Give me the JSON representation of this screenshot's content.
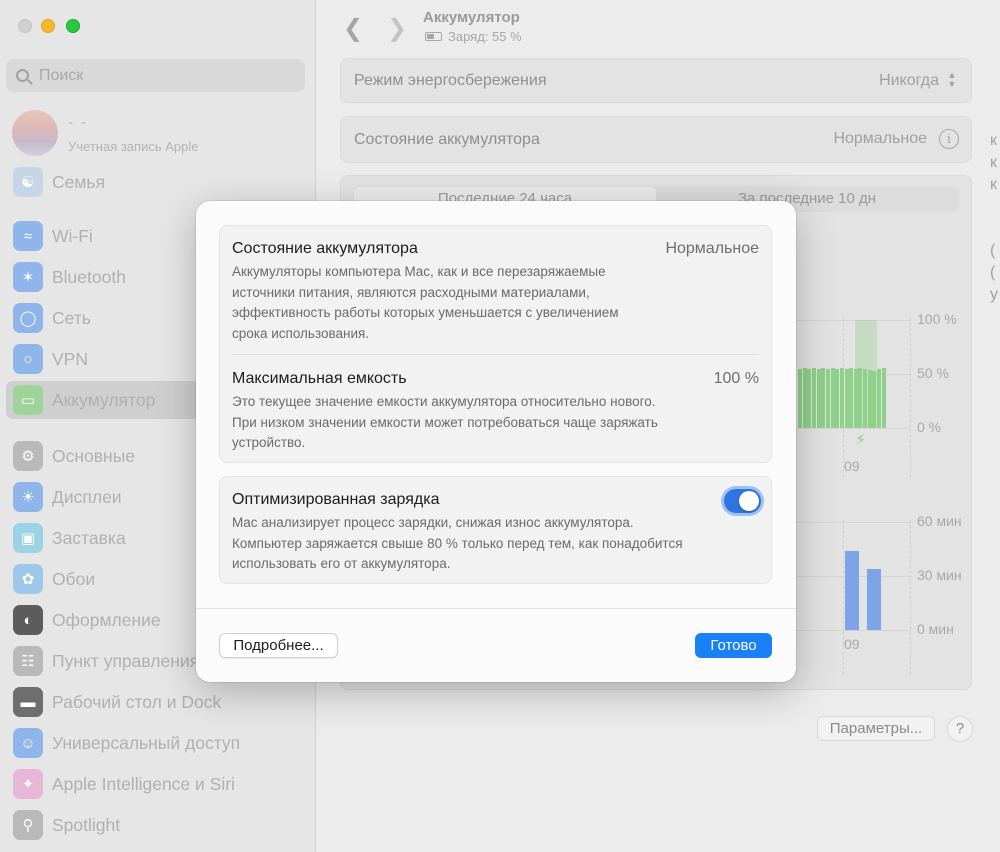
{
  "sidebar": {
    "search_placeholder": "Поиск",
    "account": {
      "name": "- -",
      "subtitle": "Учетная запись Apple"
    },
    "items": [
      {
        "label": "Семья",
        "icon": "family-icon",
        "color": "#c7d6e6"
      },
      {
        "label": "Wi-Fi",
        "icon": "wifi-icon",
        "color": "#8fb5ea"
      },
      {
        "label": "Bluetooth",
        "icon": "bluetooth-icon",
        "color": "#8fb5ea"
      },
      {
        "label": "Сеть",
        "icon": "globe-icon",
        "color": "#8fb5ea"
      },
      {
        "label": "VPN",
        "icon": "vpn-icon",
        "color": "#8fb5ea"
      },
      {
        "label": "Аккумулятор",
        "icon": "battery-icon",
        "color": "#9ed39a"
      },
      {
        "label": "Основные",
        "icon": "gear-icon",
        "color": "#b9b9b9"
      },
      {
        "label": "Дисплеи",
        "icon": "sun-icon",
        "color": "#8fb5ea"
      },
      {
        "label": "Заставка",
        "icon": "screensaver-icon",
        "color": "#9dd1e6"
      },
      {
        "label": "Обои",
        "icon": "flower-icon",
        "color": "#9dc8ea"
      },
      {
        "label": "Оформление",
        "icon": "appearance-icon",
        "color": "#5c5c5c"
      },
      {
        "label": "Пункт управления",
        "icon": "control-center-icon",
        "color": "#b9b9b9"
      },
      {
        "label": "Рабочий стол и Dock",
        "icon": "dock-icon",
        "color": "#6e6e6e"
      },
      {
        "label": "Универсальный доступ",
        "icon": "accessibility-icon",
        "color": "#8fb5ea"
      },
      {
        "label": "Apple Intelligence и Siri",
        "icon": "siri-icon",
        "color": "#e6b7d6"
      },
      {
        "label": "Spotlight",
        "icon": "spotlight-icon",
        "color": "#b9b9b9"
      }
    ],
    "active_item": "Аккумулятор"
  },
  "header": {
    "title": "Аккумулятор",
    "subtitle": "Заряд: 55 %"
  },
  "main": {
    "low_power": {
      "label": "Режим энергосбережения",
      "value": "Никогда"
    },
    "health": {
      "label": "Состояние аккумулятора",
      "value": "Нормальное"
    },
    "tabs": [
      "Последние 24 часа",
      "За последние 10 дн"
    ],
    "charge_chart": {
      "y_ticks": [
        "100 %",
        "50 %",
        "0 %"
      ],
      "x_tick": "09",
      "bar_color": "#8fd08a"
    },
    "usage_chart": {
      "y_ticks": [
        "60 мин",
        "30 мин",
        "0 мин"
      ],
      "x_tick": "09",
      "bar_color": "#7da4e6"
    },
    "params_button": "Параметры...",
    "help_button": "?",
    "edge_glyphs": [
      "к",
      "к",
      "к",
      "",
      "",
      "(",
      "(",
      "у"
    ]
  },
  "chart_data": [
    {
      "type": "bar",
      "y_ticks": [
        "100 %",
        "50 %",
        "0 %"
      ],
      "x_labels": [
        "09"
      ],
      "ylim": [
        0,
        100
      ],
      "values": [
        55,
        56,
        55,
        56,
        55,
        56,
        55,
        56,
        55,
        56,
        55,
        56,
        55,
        56,
        55,
        54,
        53,
        55,
        56
      ],
      "highlight_last": 100
    },
    {
      "type": "bar",
      "y_ticks": [
        "60 мин",
        "30 мин",
        "0 мин"
      ],
      "x_labels": [
        "09"
      ],
      "ylim": [
        0,
        60
      ],
      "values": [
        44,
        34
      ]
    }
  ],
  "modal": {
    "health": {
      "title": "Состояние аккумулятора",
      "value": "Нормальное",
      "desc": [
        "Аккумуляторы компьютера Mac, как и все перезаряжаемые",
        "источники питания, являются расходными материалами,",
        "эффективность работы которых уменьшается с увеличением",
        "срока использования."
      ]
    },
    "capacity": {
      "title": "Максимальная емкость",
      "value": "100 %",
      "desc": [
        "Это текущее значение емкости аккумулятора относительно нового.",
        "При низком значении емкости может потребоваться чаще заряжать",
        "устройство."
      ]
    },
    "optimized": {
      "title": "Оптимизированная зарядка",
      "enabled": true,
      "desc": [
        "Mac анализирует процесс зарядки, снижая износ аккумулятора.",
        "Компьютер заряжается свыше 80 % только перед тем, как понадобится",
        "использовать его от аккумулятора."
      ]
    },
    "more_button": "Подробнее...",
    "done_button": "Готово"
  }
}
